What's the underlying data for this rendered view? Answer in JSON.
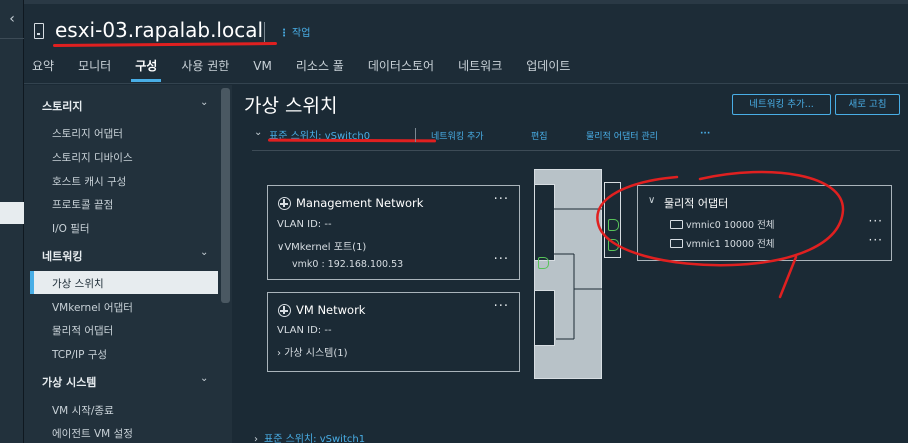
{
  "header": {
    "host_title": "esxi-03.rapalab.local",
    "actions_label": "작업",
    "tabs": [
      {
        "label": "요약"
      },
      {
        "label": "모니터"
      },
      {
        "label": "구성",
        "active": true
      },
      {
        "label": "사용 권한"
      },
      {
        "label": "VM"
      },
      {
        "label": "리소스 풀"
      },
      {
        "label": "데이터스토어"
      },
      {
        "label": "네트워크"
      },
      {
        "label": "업데이트"
      }
    ]
  },
  "nav": {
    "groups": [
      {
        "label": "스토리지",
        "items": [
          "스토리지 어댑터",
          "스토리지 디바이스",
          "호스트 캐시 구성",
          "프로토콜 끝점",
          "I/O 필터"
        ]
      },
      {
        "label": "네트워킹",
        "items": [
          "가상 스위치",
          "VMkernel 어댑터",
          "물리적 어댑터",
          "TCP/IP 구성"
        ]
      },
      {
        "label": "가상 시스템",
        "items": [
          "VM 시작/종료",
          "에이전트 VM 설정"
        ]
      }
    ],
    "active_item": "가상 스위치"
  },
  "main": {
    "title": "가상 스위치",
    "add_network_label": "네트워킹 추가...",
    "refresh_label": "새로 고침",
    "switch0": {
      "name": "표준 스위치: vSwitch0",
      "actions": [
        "네트워킹 추가",
        "편집",
        "물리적 어댑터 관리",
        "···"
      ]
    },
    "port_groups": [
      {
        "name": "Management Network",
        "vlan": "VLAN ID: --",
        "sub_label": "VMkernel 포트(1)",
        "sub_item": "vmk0 : 192.168.100.53"
      },
      {
        "name": "VM Network",
        "vlan": "VLAN ID: --",
        "sub_label": "가상 시스템(1)"
      }
    ],
    "physical": {
      "title": "물리적 어댑터",
      "nics": [
        "vmnic0 10000 전체",
        "vmnic1 10000 전체"
      ]
    },
    "switch1": {
      "name": "표준 스위치: vSwitch1"
    }
  },
  "colors": {
    "accent": "#49aee6",
    "annotation": "#e02020",
    "port": "#58c35a"
  }
}
